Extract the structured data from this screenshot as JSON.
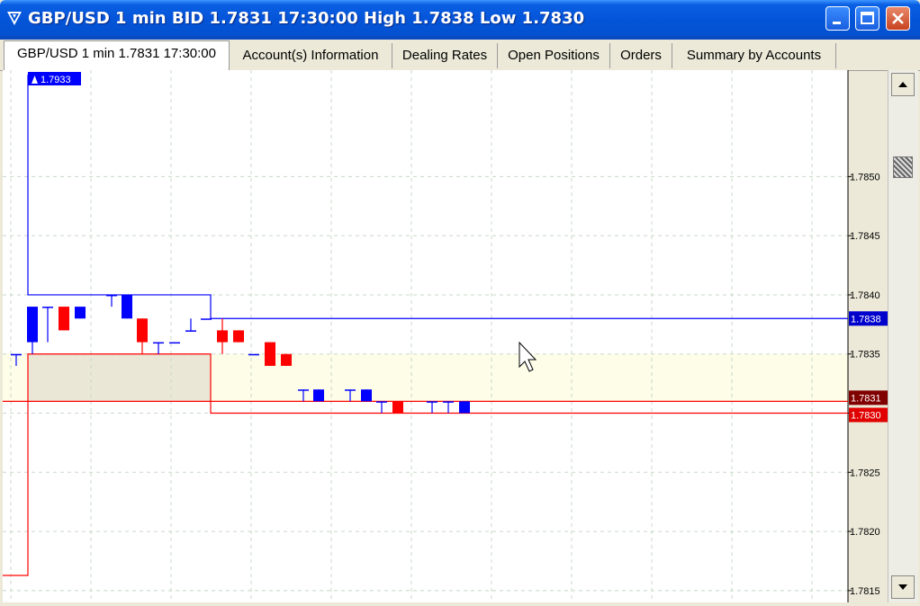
{
  "window": {
    "title": "GBP/USD 1 min BID 1.7831 17:30:00 High 1.7838 Low 1.7830",
    "icon": "fxcm-logo-icon"
  },
  "tabs": [
    {
      "label": "GBP/USD 1 min 1.7831 17:30:00",
      "active": true
    },
    {
      "label": "Account(s) Information",
      "active": false
    },
    {
      "label": "Dealing Rates",
      "active": false
    },
    {
      "label": "Open Positions",
      "active": false
    },
    {
      "label": "Orders",
      "active": false
    },
    {
      "label": "Summary by Accounts",
      "active": false
    }
  ],
  "chart_data": {
    "type": "candlestick",
    "instrument": "GBP/USD",
    "timeframe": "1 min",
    "ylim": [
      1.7814,
      1.7859
    ],
    "yticks": [
      "1.7815",
      "1.7820",
      "1.7825",
      "1.7830",
      "1.7835",
      "1.7840",
      "1.7845",
      "1.7850"
    ],
    "grid": true,
    "bullish_color": "#0000FF",
    "bearish_color": "#FF0000",
    "candles": [
      {
        "open": 1.7835,
        "close": 1.7835,
        "high": 1.7835,
        "low": 1.7834
      },
      {
        "open": 1.7836,
        "close": 1.7839,
        "high": 1.7839,
        "low": 1.7835
      },
      {
        "open": 1.7839,
        "close": 1.7839,
        "high": 1.7839,
        "low": 1.7836
      },
      {
        "open": 1.7839,
        "close": 1.7837,
        "high": 1.7839,
        "low": 1.7837
      },
      {
        "open": 1.7838,
        "close": 1.7839,
        "high": 1.7839,
        "low": 1.7838
      },
      {
        "open": 1.784,
        "close": 1.784,
        "high": 1.784,
        "low": 1.7839
      },
      {
        "open": 1.7838,
        "close": 1.784,
        "high": 1.784,
        "low": 1.7838
      },
      {
        "open": 1.7838,
        "close": 1.7836,
        "high": 1.7838,
        "low": 1.7835
      },
      {
        "open": 1.7836,
        "close": 1.7836,
        "high": 1.7836,
        "low": 1.7835
      },
      {
        "open": 1.7836,
        "close": 1.7836,
        "high": 1.7836,
        "low": 1.7836
      },
      {
        "open": 1.7837,
        "close": 1.7837,
        "high": 1.7838,
        "low": 1.7837
      },
      {
        "open": 1.7838,
        "close": 1.7838,
        "high": 1.7838,
        "low": 1.7838
      },
      {
        "open": 1.7837,
        "close": 1.7836,
        "high": 1.7838,
        "low": 1.7835
      },
      {
        "open": 1.7837,
        "close": 1.7836,
        "high": 1.7837,
        "low": 1.7836
      },
      {
        "open": 1.7835,
        "close": 1.7835,
        "high": 1.7835,
        "low": 1.7835
      },
      {
        "open": 1.7836,
        "close": 1.7834,
        "high": 1.7836,
        "low": 1.7834
      },
      {
        "open": 1.7835,
        "close": 1.7834,
        "high": 1.7835,
        "low": 1.7834
      },
      {
        "open": 1.7832,
        "close": 1.7832,
        "high": 1.7832,
        "low": 1.7831
      },
      {
        "open": 1.7831,
        "close": 1.7832,
        "high": 1.7832,
        "low": 1.7831
      },
      {
        "open": 1.7832,
        "close": 1.7832,
        "high": 1.7832,
        "low": 1.7831
      },
      {
        "open": 1.7831,
        "close": 1.7832,
        "high": 1.7832,
        "low": 1.7831
      },
      {
        "open": 1.7831,
        "close": 1.7831,
        "high": 1.7831,
        "low": 1.783
      },
      {
        "open": 1.7831,
        "close": 1.783,
        "high": 1.7831,
        "low": 1.783
      },
      {
        "open": 1.7831,
        "close": 1.7831,
        "high": 1.7831,
        "low": 1.783
      },
      {
        "open": 1.7831,
        "close": 1.7831,
        "high": 1.7831,
        "low": 1.783
      },
      {
        "open": 1.783,
        "close": 1.7831,
        "high": 1.7831,
        "low": 1.783
      }
    ],
    "peak_label": "1.7933",
    "high_line": {
      "value": 1.7838,
      "label": "1.7838",
      "color": "#0000FF"
    },
    "bid_line": {
      "value": 1.7831,
      "label": "1.7831",
      "color": "#FF0000"
    },
    "low_line": {
      "value": 1.783,
      "label": "1.7830",
      "color": "#FF0000"
    },
    "band": {
      "from": 1.7831,
      "to": 1.7835,
      "color": "#FDFDE8"
    }
  }
}
